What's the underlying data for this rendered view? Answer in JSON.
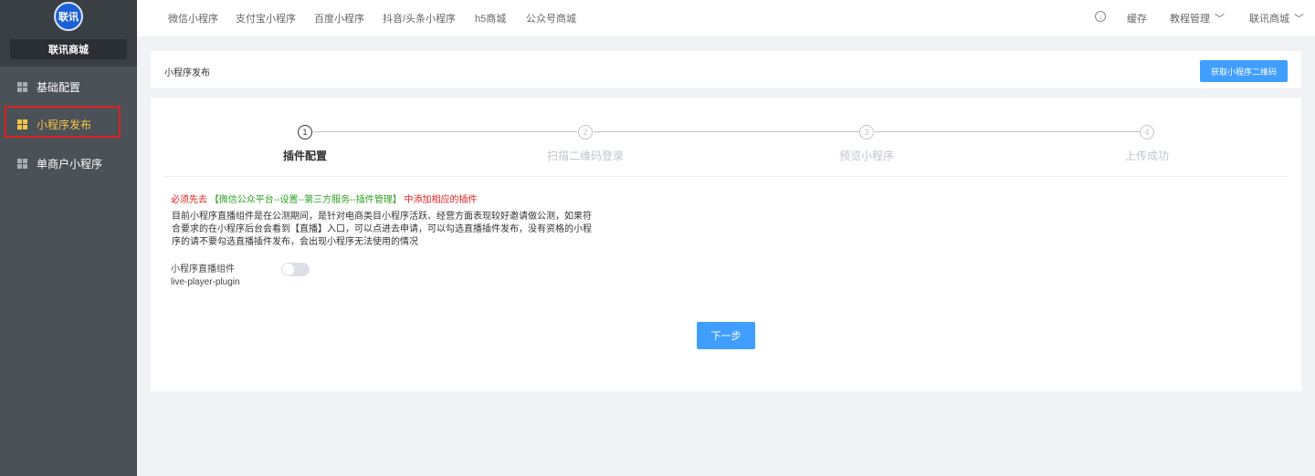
{
  "sidebar": {
    "logo_text": "联讯",
    "store_name": "联讯商城",
    "items": [
      {
        "label": "基础配置",
        "active": false
      },
      {
        "label": "小程序发布",
        "active": true
      },
      {
        "label": "单商户小程序",
        "active": false
      }
    ]
  },
  "topbar": {
    "nav": [
      "微信小程序",
      "支付宝小程序",
      "百度小程序",
      "抖音/头条小程序",
      "h5商城",
      "公众号商城"
    ],
    "cache_label": "缓存",
    "tutorial_label": "教程管理",
    "user_label": "联讯商城"
  },
  "header": {
    "title": "小程序发布",
    "qr_button": "获取小程序二维码"
  },
  "steps": [
    {
      "num": "1",
      "label": "插件配置",
      "active": true
    },
    {
      "num": "2",
      "label": "扫描二维码登录",
      "active": false
    },
    {
      "num": "3",
      "label": "预览小程序",
      "active": false
    },
    {
      "num": "4",
      "label": "上传成功",
      "active": false
    }
  ],
  "content": {
    "notice_prefix": "必须先去",
    "notice_path": "【微信公众平台--设置--第三方服务--插件管理】",
    "notice_suffix": "中添加相应的插件",
    "description": "目前小程序直播组件是在公测期间，是针对电商类目小程序活跃、经营方面表现较好邀请做公测，如果符合要求的在小程序后台会看到【直播】入口，可以点进去申请，可以勾选直播插件发布，没有资格的小程序的请不要勾选直播插件发布，会出现小程序无法使用的情况",
    "plugin_name": "小程序直播组件",
    "plugin_id": "live-player-plugin",
    "plugin_enabled": false,
    "next_button": "下一步"
  }
}
